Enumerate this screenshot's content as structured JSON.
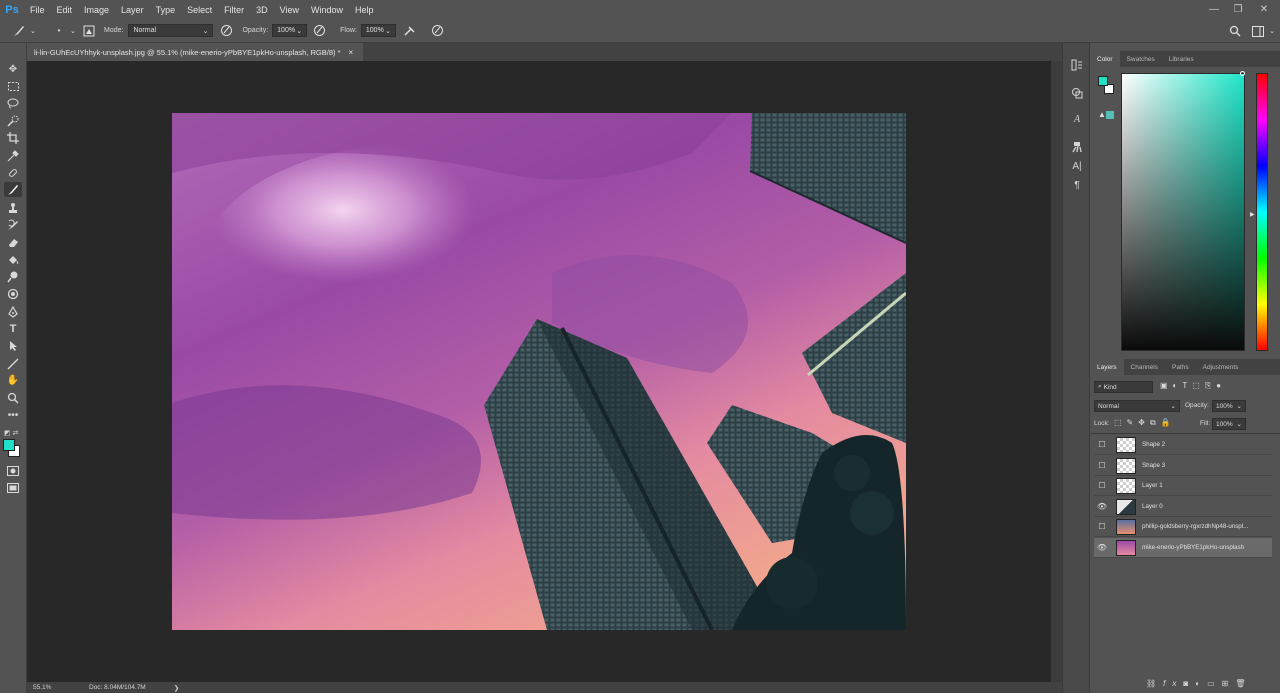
{
  "app": {
    "logo": "Ps",
    "menu": [
      "File",
      "Edit",
      "Image",
      "Layer",
      "Type",
      "Select",
      "Filter",
      "3D",
      "View",
      "Window",
      "Help"
    ]
  },
  "options": {
    "mode_label": "Mode:",
    "mode_value": "Normal",
    "opacity_label": "Opacity:",
    "opacity_value": "100%",
    "flow_label": "Flow:",
    "flow_value": "100%"
  },
  "document": {
    "tab_title": "li-lin-GUhEcUYhhyk-unsplash.jpg @ 55.1% (mike-enerio-yPbBYE1pkHo-unsplash, RGB/8) *",
    "tab_close": "×"
  },
  "status": {
    "zoom": "55.1%",
    "doc_size": "Doc: 8.04M/104.7M",
    "arrow": "❯"
  },
  "color_panel": {
    "tabs": [
      "Color",
      "Swatches",
      "Libraries"
    ],
    "fg_color": "#22e0c8",
    "bg_color": "#ffffff"
  },
  "layers_panel": {
    "tabs": [
      "Layers",
      "Channels",
      "Paths",
      "Adjustments"
    ],
    "kind_label": "Kind",
    "blend_mode": "Normal",
    "opacity_label": "Opacity:",
    "opacity_value": "100%",
    "lock_label": "Lock:",
    "fill_label": "Fill:",
    "fill_value": "100%",
    "layers": [
      {
        "name": "Shape 2",
        "visible": false
      },
      {
        "name": "Shape 3",
        "visible": false
      },
      {
        "name": "Layer 1",
        "visible": false
      },
      {
        "name": "Layer 0",
        "visible": true
      },
      {
        "name": "phillip-goldsberry-rgxrzdhNp48-unspl...",
        "visible": false
      },
      {
        "name": "mike-enerio-yPbBYE1pkHo-unsplash",
        "visible": true
      }
    ]
  }
}
